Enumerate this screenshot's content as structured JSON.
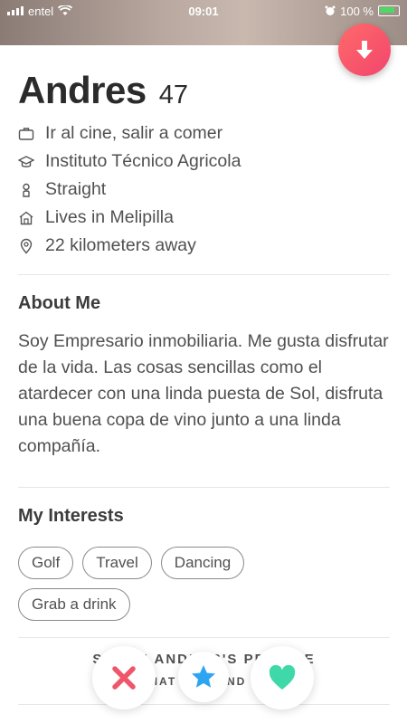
{
  "status_bar": {
    "carrier": "entel",
    "time": "09:01",
    "battery": "100 %"
  },
  "profile": {
    "name": "Andres",
    "age": "47"
  },
  "info": [
    {
      "icon": "briefcase-icon",
      "text": "Ir al cine, salir a comer"
    },
    {
      "icon": "graduation-cap-icon",
      "text": "Instituto Técnico Agricola"
    },
    {
      "icon": "person-icon",
      "text": "Straight"
    },
    {
      "icon": "home-icon",
      "text": "Lives in Melipilla"
    },
    {
      "icon": "location-pin-icon",
      "text": "22 kilometers away"
    }
  ],
  "about": {
    "title": "About Me",
    "text": "Soy Empresario inmobiliaria. Me gusta disfrutar de la vida. Las cosas sencillas como el atardecer con una linda puesta de Sol, disfruta una buena copa de vino junto a una linda compañía."
  },
  "interests": {
    "title": "My Interests",
    "items": [
      "Golf",
      "Travel",
      "Dancing",
      "Grab a drink"
    ]
  },
  "share": {
    "line1": "SHARE ANDRES'S PROFILE",
    "line2": "SEE WHAT A FRIEND THINKS"
  },
  "actions": [
    {
      "icon": "close-icon",
      "color": "#f0566a"
    },
    {
      "icon": "star-icon",
      "color": "#2da5f2"
    },
    {
      "icon": "heart-icon",
      "color": "#3fd8a8"
    }
  ],
  "colors": {
    "accent": "#f2466c",
    "text": "#505050"
  }
}
